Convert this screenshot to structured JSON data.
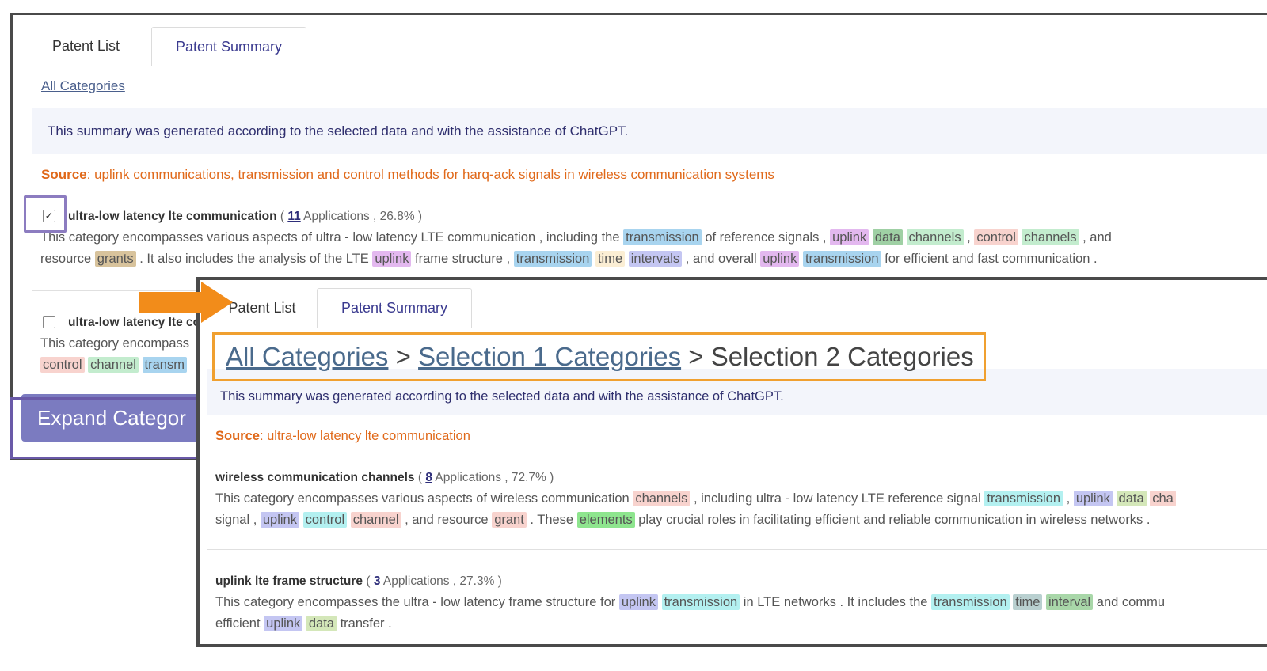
{
  "back": {
    "tabs": [
      {
        "label": "Patent List"
      },
      {
        "label": "Patent Summary"
      }
    ],
    "breadcrumb": "All Categories",
    "notice": "This summary was generated according to the selected data and with the assistance of ChatGPT.",
    "source_label": "Source",
    "source_text": ": uplink communications, transmission and control methods for harq-ack signals in wireless communication systems",
    "categories": [
      {
        "name": "ultra-low latency lte communication",
        "count": "11",
        "stats": " Applications , 26.8% )",
        "lines": [
          [
            {
              "t": "This category encompasses various aspects of ultra - low latency LTE communication , including the "
            },
            {
              "t": "transmission",
              "c": "blue"
            },
            {
              "t": " of reference signals , "
            },
            {
              "t": "uplink",
              "c": "purple"
            },
            {
              "t": " "
            },
            {
              "t": "data",
              "c": "darkgreen"
            },
            {
              "t": " "
            },
            {
              "t": "channels",
              "c": "green"
            },
            {
              "t": " , "
            },
            {
              "t": "control",
              "c": "pink"
            },
            {
              "t": " "
            },
            {
              "t": "channels",
              "c": "green"
            },
            {
              "t": " , and"
            }
          ],
          [
            {
              "t": "resource "
            },
            {
              "t": "grants",
              "c": "tan"
            },
            {
              "t": " . It also includes the analysis of the LTE "
            },
            {
              "t": "uplink",
              "c": "purple"
            },
            {
              "t": " frame structure , "
            },
            {
              "t": "transmission",
              "c": "blue"
            },
            {
              "t": " "
            },
            {
              "t": "time",
              "c": "cream"
            },
            {
              "t": " "
            },
            {
              "t": "intervals",
              "c": "lav"
            },
            {
              "t": " , and overall "
            },
            {
              "t": "uplink",
              "c": "purple"
            },
            {
              "t": " "
            },
            {
              "t": "transmission",
              "c": "blue"
            },
            {
              "t": " for efficient and fast communication ."
            }
          ]
        ]
      },
      {
        "name": "ultra-low latency lte co",
        "lines": [
          [
            {
              "t": "This category encompass"
            }
          ],
          [
            {
              "t": "control",
              "c": "pink"
            },
            {
              "t": " "
            },
            {
              "t": "channel",
              "c": "green"
            },
            {
              "t": " "
            },
            {
              "t": "transm",
              "c": "blue"
            }
          ]
        ]
      }
    ],
    "expand_button": "Expand Categor"
  },
  "front": {
    "tabs": [
      {
        "label": "Patent List"
      },
      {
        "label": "Patent Summary"
      }
    ],
    "breadcrumb": {
      "all": "All Categories",
      "sep": " > ",
      "sel1": "Selection 1 Categories",
      "sel2": "Selection 2 Categories"
    },
    "notice": "This summary was generated according to the selected data and with the assistance of ChatGPT.",
    "source_label": "Source",
    "source_text": ": ultra-low latency lte communication",
    "categories": [
      {
        "name": "wireless communication channels",
        "count": "8",
        "stats": " Applications , 72.7% )",
        "lines": [
          [
            {
              "t": "This category encompasses various aspects of wireless communication "
            },
            {
              "t": "channels",
              "c": "pink"
            },
            {
              "t": " , including ultra - low latency LTE reference signal "
            },
            {
              "t": "transmission",
              "c": "cyan"
            },
            {
              "t": " , "
            },
            {
              "t": "uplink",
              "c": "lav"
            },
            {
              "t": " "
            },
            {
              "t": "data",
              "c": "olive"
            },
            {
              "t": " "
            },
            {
              "t": "cha",
              "c": "pink"
            }
          ],
          [
            {
              "t": "signal , "
            },
            {
              "t": "uplink",
              "c": "lav"
            },
            {
              "t": " "
            },
            {
              "t": "control",
              "c": "cyan"
            },
            {
              "t": " "
            },
            {
              "t": "channel",
              "c": "pink"
            },
            {
              "t": " , and resource "
            },
            {
              "t": "grant",
              "c": "pink"
            },
            {
              "t": " . These "
            },
            {
              "t": "elements",
              "c": "lime"
            },
            {
              "t": " play crucial roles in facilitating efficient and reliable communication in wireless networks ."
            }
          ]
        ]
      },
      {
        "name": "uplink lte frame structure",
        "count": "3",
        "stats": " Applications , 27.3% )",
        "lines": [
          [
            {
              "t": "This category encompasses the ultra - low latency frame structure for "
            },
            {
              "t": "uplink",
              "c": "lav"
            },
            {
              "t": " "
            },
            {
              "t": "transmission",
              "c": "cyan"
            },
            {
              "t": " in LTE networks . It includes the "
            },
            {
              "t": "transmission",
              "c": "cyan"
            },
            {
              "t": " "
            },
            {
              "t": "time",
              "c": "gray"
            },
            {
              "t": " "
            },
            {
              "t": "interval",
              "c": "mint"
            },
            {
              "t": " and commu"
            }
          ],
          [
            {
              "t": "efficient "
            },
            {
              "t": "uplink",
              "c": "lav"
            },
            {
              "t": " "
            },
            {
              "t": "data",
              "c": "olive"
            },
            {
              "t": " transfer ."
            }
          ]
        ]
      }
    ]
  }
}
